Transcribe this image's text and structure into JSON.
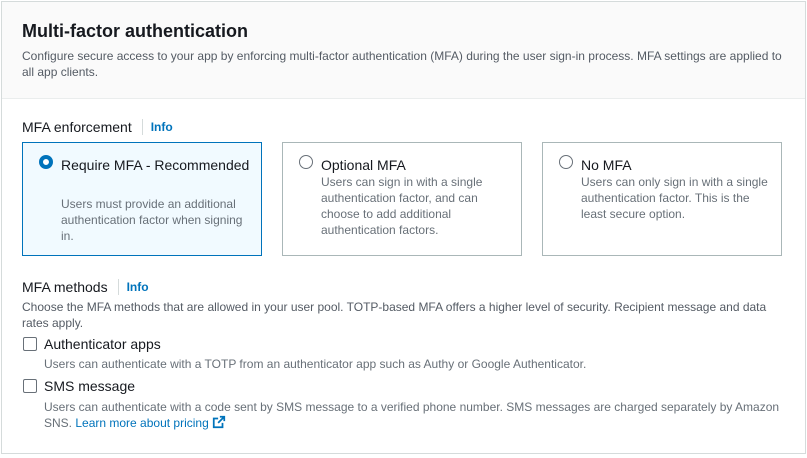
{
  "header": {
    "title": "Multi-factor authentication",
    "description": "Configure secure access to your app by enforcing multi-factor authentication (MFA) during the user sign-in process. MFA settings are applied to all app clients."
  },
  "enforcement": {
    "label": "MFA enforcement",
    "info": "Info",
    "options": [
      {
        "title": "Require MFA - Recommended",
        "description": "Users must provide an additional authentication factor when signing in.",
        "selected": true
      },
      {
        "title": "Optional MFA",
        "description": "Users can sign in with a single authentication factor, and can choose to add additional authentication factors.",
        "selected": false
      },
      {
        "title": "No MFA",
        "description": "Users can only sign in with a single authentication factor. This is the least secure option.",
        "selected": false
      }
    ]
  },
  "methods": {
    "label": "MFA methods",
    "info": "Info",
    "description": "Choose the MFA methods that are allowed in your user pool. TOTP-based MFA offers a higher level of security. Recipient message and data rates apply.",
    "items": [
      {
        "label": "Authenticator apps",
        "description": "Users can authenticate with a TOTP from an authenticator app such as Authy or Google Authenticator.",
        "checked": false
      },
      {
        "label": "SMS message",
        "description": "Users can authenticate with a code sent by SMS message to a verified phone number. SMS messages are charged separately by Amazon SNS.",
        "link": "Learn more about pricing",
        "checked": false
      }
    ]
  },
  "colors": {
    "accent": "#0073bb",
    "selected_tile_bg": "#f1faff",
    "border": "#aab7b8"
  },
  "icons": {
    "external_link": "external-link-icon"
  }
}
